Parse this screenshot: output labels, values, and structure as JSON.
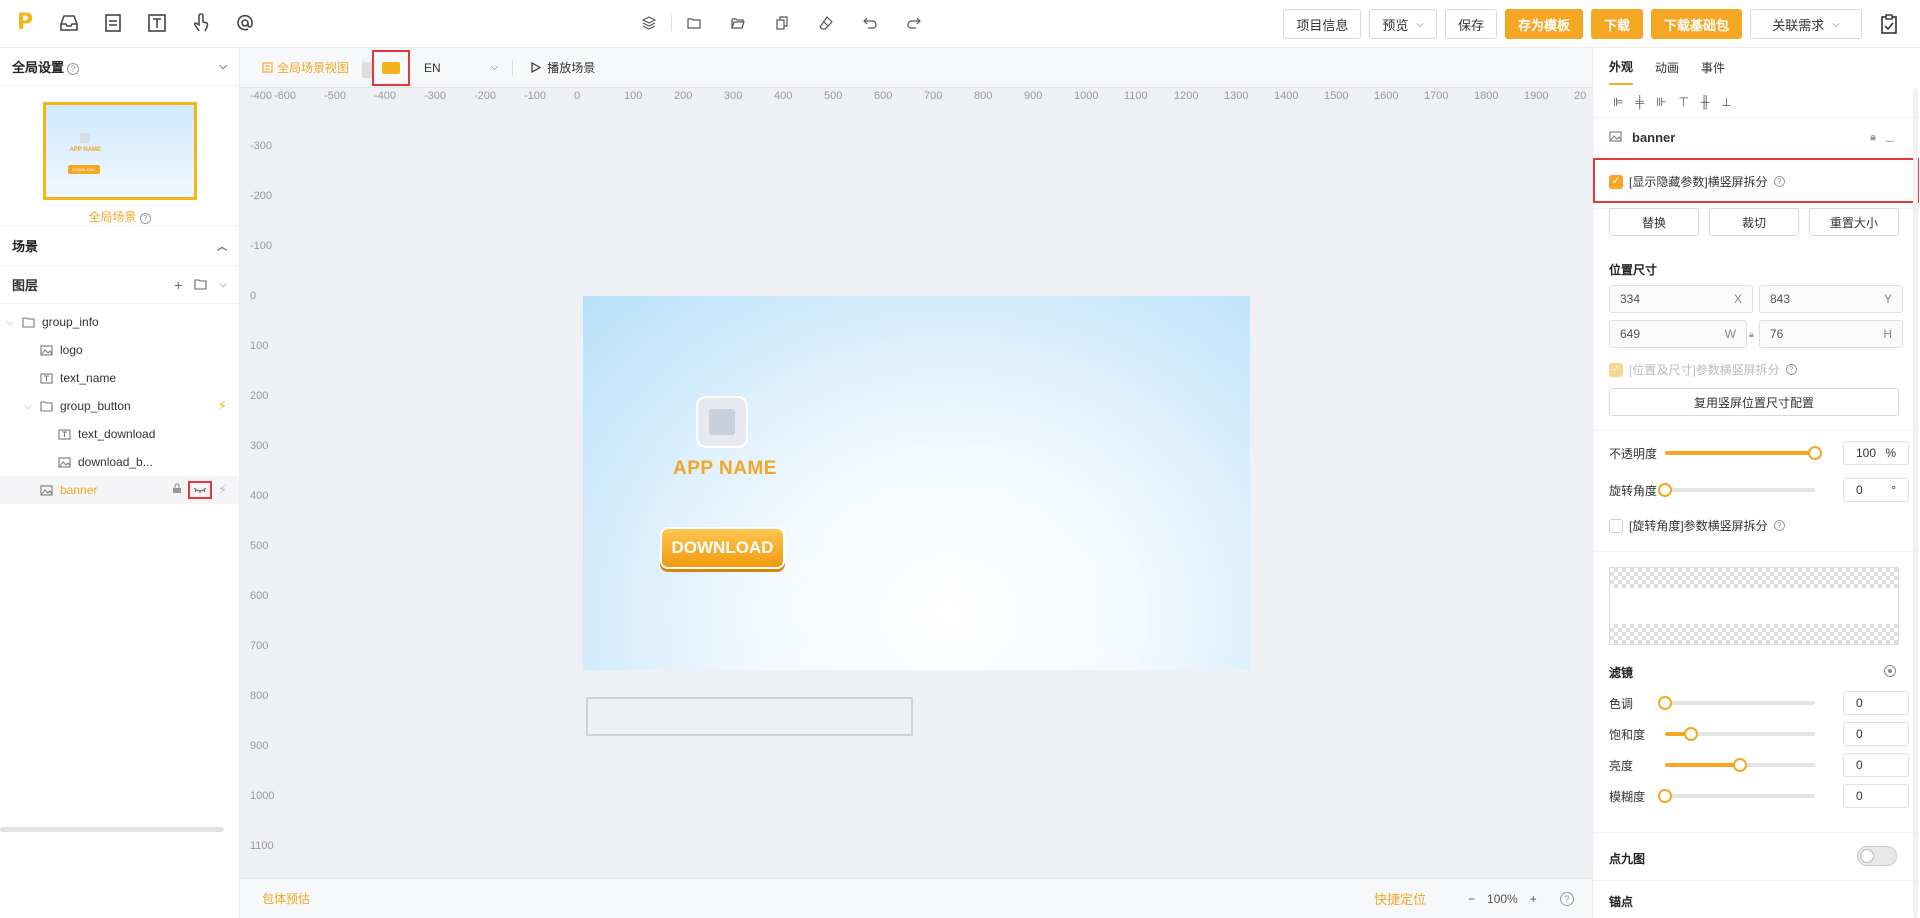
{
  "toolbar": {
    "logo": "P",
    "buttons": {
      "project_info": "项目信息",
      "preview": "预览",
      "save": "保存",
      "save_template": "存为模板",
      "download": "下载",
      "download_base": "下载基础包",
      "link_requirement": "关联需求"
    }
  },
  "left": {
    "global_settings": "全局设置",
    "global_scene": "全局场景",
    "thumb_app_name": "APP NAME",
    "thumb_download": "DOWNLOAD",
    "scene": "场景",
    "layers": "图层",
    "tree": [
      {
        "label": "group_info"
      },
      {
        "label": "logo"
      },
      {
        "label": "text_name"
      },
      {
        "label": "group_button"
      },
      {
        "label": "text_download"
      },
      {
        "label": "download_b..."
      },
      {
        "label": "banner"
      }
    ]
  },
  "canvas": {
    "view_label": "全局场景视图",
    "lang": "EN",
    "play": "播放场景",
    "ruler_x": [
      "-600",
      "-500",
      "-400",
      "-300",
      "-200",
      "-100",
      "0",
      "100",
      "200",
      "300",
      "400",
      "500",
      "600",
      "700",
      "800",
      "900",
      "1000",
      "1100",
      "1200",
      "1300",
      "1400",
      "1500",
      "1600",
      "1700",
      "1800",
      "1900",
      "20"
    ],
    "ruler_y": [
      "-400",
      "-300",
      "-200",
      "-100",
      "0",
      "100",
      "200",
      "300",
      "400",
      "500",
      "600",
      "700",
      "800",
      "900",
      "1000",
      "1100"
    ],
    "app_name": "APP NAME",
    "download": "DOWNLOAD",
    "package_estimate": "包体预估",
    "quick_locate": "快捷定位",
    "zoom": "100%",
    "zoom_minus": "−",
    "zoom_plus": "+"
  },
  "right": {
    "tabs": [
      "外观",
      "动画",
      "事件"
    ],
    "object_name": "banner",
    "show_hidden_split": "[显示隐藏参数]横竖屏拆分",
    "replace": "替换",
    "crop": "裁切",
    "reset_size": "重置大小",
    "pos_size": "位置尺寸",
    "x": "334",
    "x_label": "X",
    "y": "843",
    "y_label": "Y",
    "w": "649",
    "w_label": "W",
    "h": "76",
    "h_label": "H",
    "pos_split": "[位置及尺寸]参数横竖屏拆分",
    "reuse_portrait": "复用竖屏位置尺寸配置",
    "opacity_label": "不透明度",
    "opacity": "100",
    "opacity_unit": "%",
    "rotation_label": "旋转角度",
    "rotation": "0",
    "rotation_unit": "°",
    "rotation_split": "[旋转角度]参数横竖屏拆分",
    "filter": "滤镜",
    "hue_label": "色调",
    "hue": "0",
    "saturation_label": "饱和度",
    "saturation": "0",
    "brightness_label": "亮度",
    "brightness": "0",
    "blur_label": "模糊度",
    "blur": "0",
    "nine_patch": "点九图",
    "anchor": "锚点",
    "slider_levels": {
      "opacity": 1.0,
      "rotation": 0.0,
      "hue": 0.0,
      "saturation": 0.17,
      "brightness": 0.5,
      "blur": 0.0
    }
  },
  "colors": {
    "accent": "#f5a623",
    "highlight_red": "#e4393c"
  }
}
